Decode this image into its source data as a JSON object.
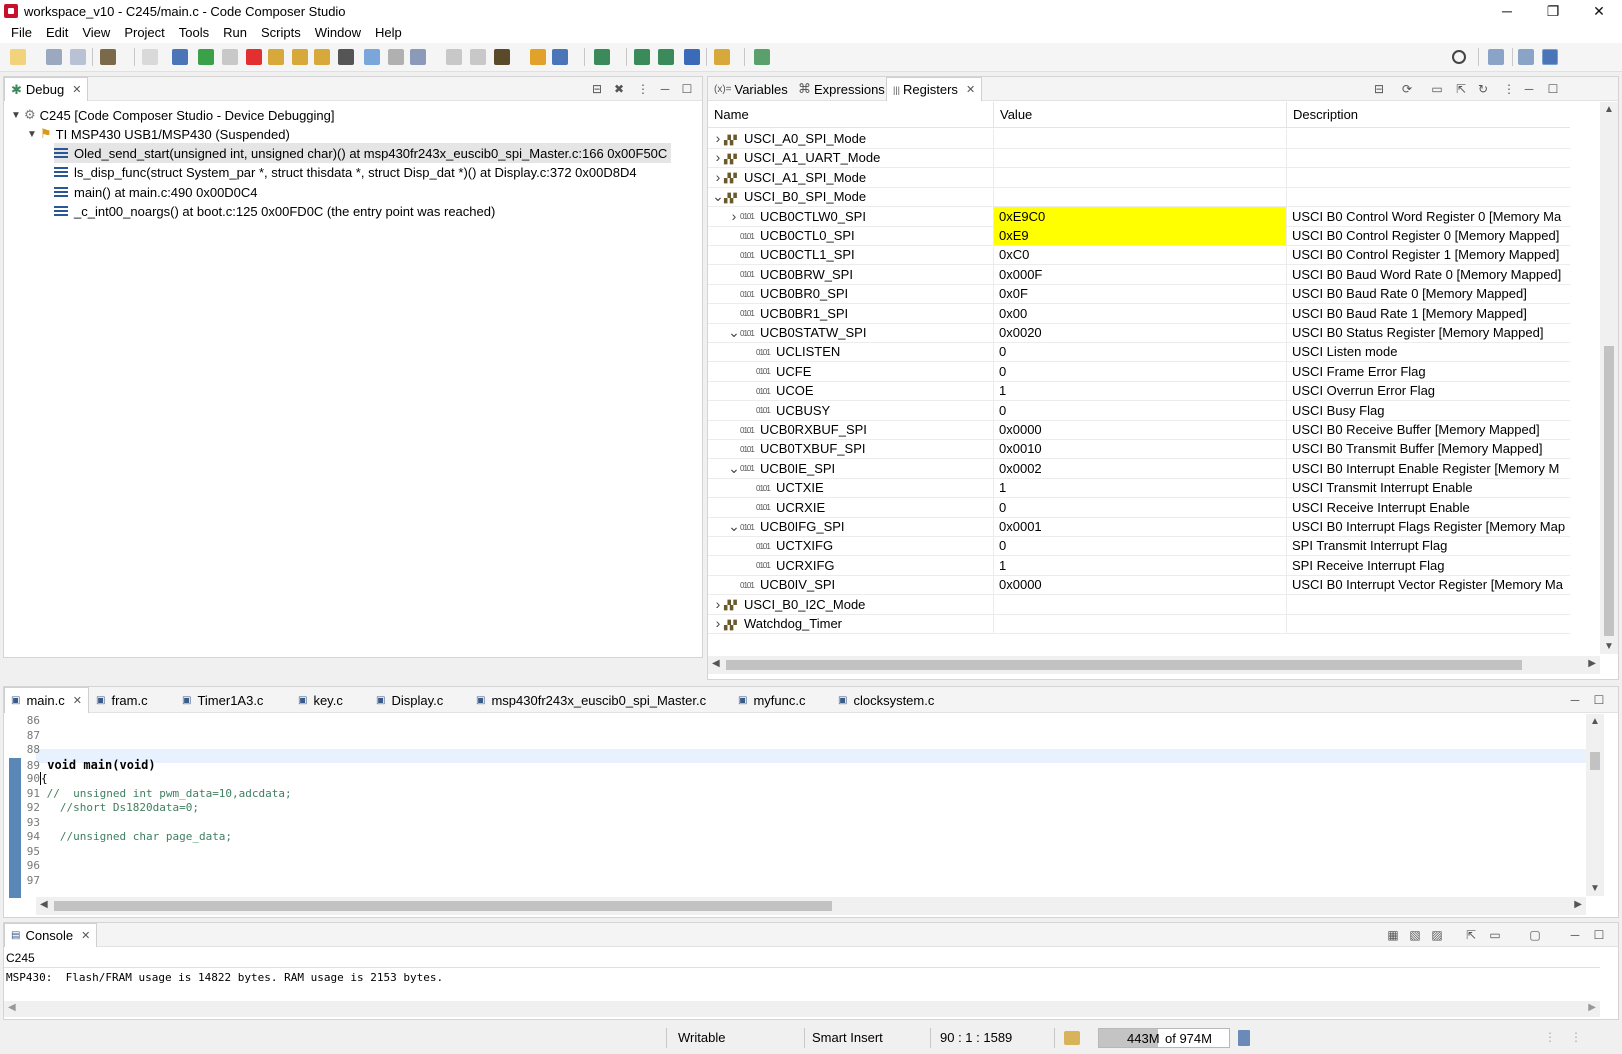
{
  "window": {
    "title": "workspace_v10 - C245/main.c - Code Composer Studio",
    "controls": [
      "─",
      "❐",
      "✕"
    ]
  },
  "menu": [
    "File",
    "Edit",
    "View",
    "Project",
    "Tools",
    "Run",
    "Scripts",
    "Window",
    "Help"
  ],
  "debug_panel": {
    "tab_label": "Debug",
    "tree": [
      {
        "label": "C245 [Code Composer Studio - Device Debugging]",
        "level": 0
      },
      {
        "label": "TI MSP430 USB1/MSP430 (Suspended)",
        "level": 1
      },
      {
        "label": "Oled_send_start(unsigned int, unsigned char)() at msp430fr243x_euscib0_spi_Master.c:166 0x00F50C",
        "level": 2,
        "selected": true
      },
      {
        "label": "ls_disp_func(struct System_par *, struct thisdata *, struct Disp_dat *)() at Display.c:372 0x00D8D4",
        "level": 2
      },
      {
        "label": "main() at main.c:490 0x00D0C4",
        "level": 2
      },
      {
        "label": "_c_int00_noargs() at boot.c:125 0x00FD0C  (the entry point was reached)",
        "level": 2
      }
    ]
  },
  "registers_panel": {
    "tabs": [
      "Variables",
      "Expressions",
      "Registers"
    ],
    "columns": [
      "Name",
      "Value",
      "Description"
    ],
    "rows": [
      {
        "name": "USCI_A0_SPI_Mode",
        "value": "",
        "desc": "",
        "level": 0,
        "twisty": "right",
        "group": true
      },
      {
        "name": "USCI_A1_UART_Mode",
        "value": "",
        "desc": "",
        "level": 0,
        "twisty": "right",
        "group": true
      },
      {
        "name": "USCI_A1_SPI_Mode",
        "value": "",
        "desc": "",
        "level": 0,
        "twisty": "right",
        "group": true
      },
      {
        "name": "USCI_B0_SPI_Mode",
        "value": "",
        "desc": "",
        "level": 0,
        "twisty": "down",
        "group": true
      },
      {
        "name": "UCB0CTLW0_SPI",
        "value": "0xE9C0",
        "desc": "USCI B0 Control Word Register 0 [Memory Ma",
        "level": 1,
        "twisty": "right",
        "highlight": true
      },
      {
        "name": "UCB0CTL0_SPI",
        "value": "0xE9",
        "desc": "USCI B0 Control Register 0 [Memory Mapped]",
        "level": 1,
        "twisty": "",
        "highlight": true
      },
      {
        "name": "UCB0CTL1_SPI",
        "value": "0xC0",
        "desc": "USCI B0 Control Register 1 [Memory Mapped]",
        "level": 1,
        "twisty": ""
      },
      {
        "name": "UCB0BRW_SPI",
        "value": "0x000F",
        "desc": "USCI B0 Baud Word Rate 0 [Memory Mapped]",
        "level": 1,
        "twisty": ""
      },
      {
        "name": "UCB0BR0_SPI",
        "value": "0x0F",
        "desc": "USCI B0 Baud Rate 0 [Memory Mapped]",
        "level": 1,
        "twisty": ""
      },
      {
        "name": "UCB0BR1_SPI",
        "value": "0x00",
        "desc": "USCI B0 Baud Rate 1 [Memory Mapped]",
        "level": 1,
        "twisty": ""
      },
      {
        "name": "UCB0STATW_SPI",
        "value": "0x0020",
        "desc": "USCI B0 Status Register [Memory Mapped]",
        "level": 1,
        "twisty": "down"
      },
      {
        "name": "UCLISTEN",
        "value": "0",
        "desc": "USCI Listen mode",
        "level": 2,
        "twisty": ""
      },
      {
        "name": "UCFE",
        "value": "0",
        "desc": "USCI Frame Error Flag",
        "level": 2,
        "twisty": ""
      },
      {
        "name": "UCOE",
        "value": "1",
        "desc": "USCI Overrun Error Flag",
        "level": 2,
        "twisty": ""
      },
      {
        "name": "UCBUSY",
        "value": "0",
        "desc": "USCI Busy Flag",
        "level": 2,
        "twisty": ""
      },
      {
        "name": "UCB0RXBUF_SPI",
        "value": "0x0000",
        "desc": "USCI B0 Receive Buffer [Memory Mapped]",
        "level": 1,
        "twisty": ""
      },
      {
        "name": "UCB0TXBUF_SPI",
        "value": "0x0010",
        "desc": "USCI B0 Transmit Buffer [Memory Mapped]",
        "level": 1,
        "twisty": ""
      },
      {
        "name": "UCB0IE_SPI",
        "value": "0x0002",
        "desc": "USCI B0 Interrupt Enable Register [Memory M",
        "level": 1,
        "twisty": "down"
      },
      {
        "name": "UCTXIE",
        "value": "1",
        "desc": "USCI Transmit Interrupt Enable",
        "level": 2,
        "twisty": ""
      },
      {
        "name": "UCRXIE",
        "value": "0",
        "desc": "USCI Receive Interrupt Enable",
        "level": 2,
        "twisty": ""
      },
      {
        "name": "UCB0IFG_SPI",
        "value": "0x0001",
        "desc": "USCI B0 Interrupt Flags Register [Memory Map",
        "level": 1,
        "twisty": "down"
      },
      {
        "name": "UCTXIFG",
        "value": "0",
        "desc": "SPI Transmit Interrupt Flag",
        "level": 2,
        "twisty": ""
      },
      {
        "name": "UCRXIFG",
        "value": "1",
        "desc": "SPI Receive Interrupt Flag",
        "level": 2,
        "twisty": ""
      },
      {
        "name": "UCB0IV_SPI",
        "value": "0x0000",
        "desc": "USCI B0 Interrupt Vector Register [Memory Ma",
        "level": 1,
        "twisty": ""
      },
      {
        "name": "USCI_B0_I2C_Mode",
        "value": "",
        "desc": "",
        "level": 0,
        "twisty": "right",
        "group": true
      },
      {
        "name": "Watchdog_Timer",
        "value": "",
        "desc": "",
        "level": 0,
        "twisty": "right",
        "group": true
      }
    ]
  },
  "editor": {
    "tabs": [
      "main.c",
      "fram.c",
      "Timer1A3.c",
      "key.c",
      "Display.c",
      "msp430fr243x_euscib0_spi_Master.c",
      "myfunc.c",
      "clocksystem.c"
    ],
    "lines": [
      {
        "num": "86",
        "text": ""
      },
      {
        "num": "87",
        "text": ""
      },
      {
        "num": "88",
        "text": ""
      },
      {
        "num": "89",
        "text": "void main(void)"
      },
      {
        "num": "90",
        "text": "{"
      },
      {
        "num": "91",
        "text": "//  unsigned int pwm_data=10,adcdata;"
      },
      {
        "num": "92",
        "text": "  //short Ds1820data=0;"
      },
      {
        "num": "93",
        "text": ""
      },
      {
        "num": "94",
        "text": "  //unsigned char page_data;"
      },
      {
        "num": "95",
        "text": ""
      },
      {
        "num": "96",
        "text": ""
      },
      {
        "num": "97",
        "text": ""
      }
    ]
  },
  "console": {
    "tab_label": "Console",
    "name": "C245",
    "output": "MSP430:  Flash/FRAM usage is 14822 bytes. RAM usage is 2153 bytes."
  },
  "status": {
    "writable": "Writable",
    "insert_mode": "Smart Insert",
    "position": "90 : 1 : 1589",
    "heap_used": "443M",
    "heap_total": "of 974M",
    "heap_fraction": 0.455
  },
  "colors": {
    "highlight": "#ffff00",
    "selection": "#e5e5e5",
    "gutter": "#5b87b8",
    "keyword": "#7f0055",
    "comment": "#3f7f5f"
  }
}
